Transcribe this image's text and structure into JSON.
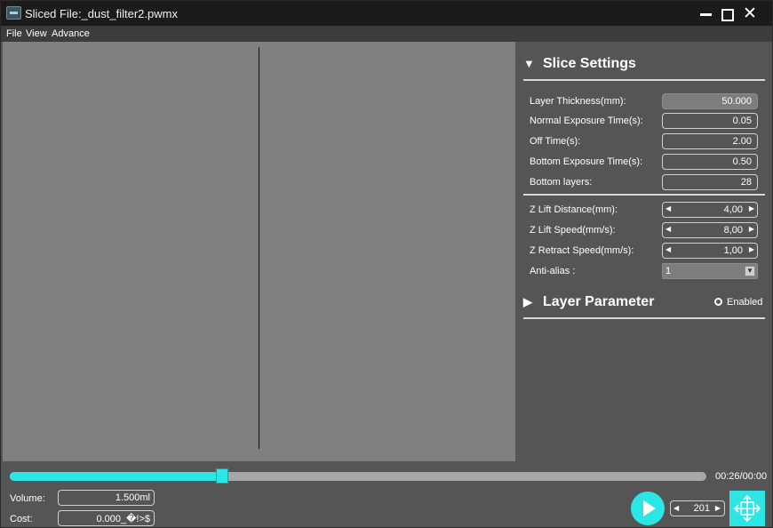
{
  "window": {
    "title": "Sliced File:_dust_filter2.pwmx"
  },
  "menu": [
    "File",
    "View",
    "Advance"
  ],
  "slice_settings": {
    "title": "Slice Settings",
    "rows": [
      {
        "label": "Layer Thickness(mm):",
        "value": "50.000"
      },
      {
        "label": "Normal Exposure Time(s):",
        "value": "0.05"
      },
      {
        "label": "Off Time(s):",
        "value": "2.00"
      },
      {
        "label": "Bottom Exposure Time(s):",
        "value": "0.50"
      },
      {
        "label": "Bottom layers:",
        "value": "28"
      }
    ],
    "spin_rows": [
      {
        "label": "Z Lift Distance(mm):",
        "value": "4,00"
      },
      {
        "label": "Z Lift Speed(mm/s):",
        "value": "8,00"
      },
      {
        "label": "Z Retract Speed(mm/s):",
        "value": "1,00"
      }
    ],
    "anti_alias": {
      "label": "Anti-alias :",
      "value": "1"
    }
  },
  "layer_parameter": {
    "title": "Layer Parameter",
    "enabled_label": "Enabled"
  },
  "bottom": {
    "progress_fraction": 0.305,
    "time": "00:26/00:00",
    "volume_label": "Volume:",
    "volume_value": "1.500ml",
    "cost_label": "Cost:",
    "cost_value": "0.000_�!>$",
    "layer_value": "201"
  },
  "colors": {
    "accent": "#2ce6e6",
    "viewport": "#808080",
    "panel": "#555555"
  },
  "icons": {
    "play": "play-icon",
    "move": "move-arrows-icon",
    "close": "close-icon",
    "minimize": "minimize-icon",
    "maximize": "maximize-icon"
  }
}
